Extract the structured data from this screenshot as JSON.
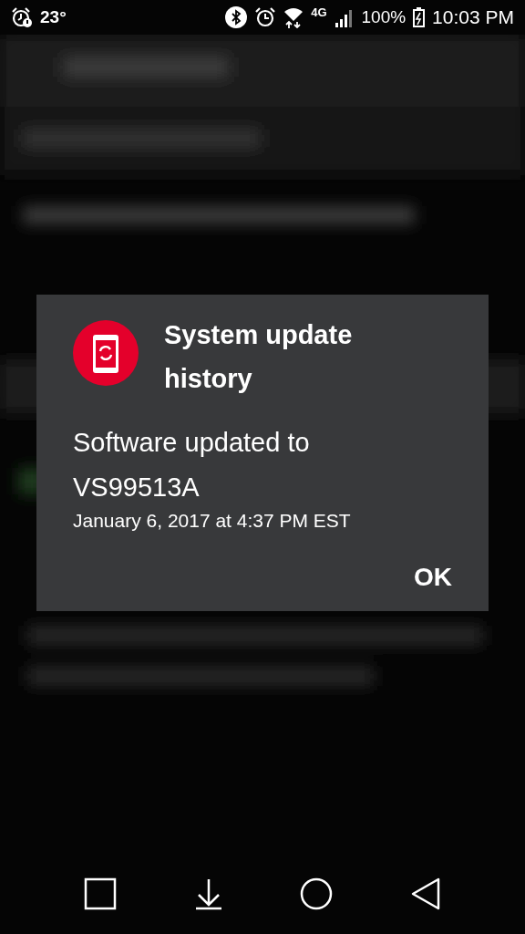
{
  "status_bar": {
    "temperature": "23°",
    "network_type": "4G",
    "battery": "100%",
    "time": "10:03 PM"
  },
  "dialog": {
    "title": "System update history",
    "message": "Software updated to VS99513A",
    "timestamp": "January 6, 2017 at 4:37 PM EST",
    "buttons": [
      "OK"
    ]
  }
}
